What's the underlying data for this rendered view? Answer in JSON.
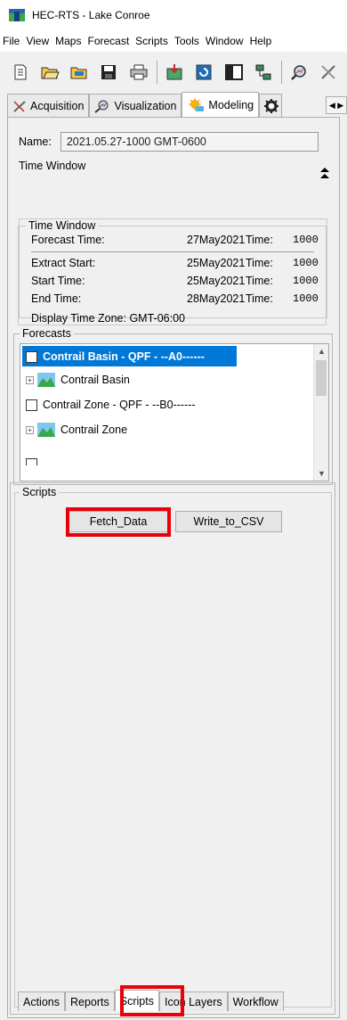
{
  "window": {
    "title": "HEC-RTS - Lake Conroe"
  },
  "menu": [
    "File",
    "View",
    "Maps",
    "Forecast",
    "Scripts",
    "Tools",
    "Window",
    "Help"
  ],
  "toolbar": {
    "buttons": [
      {
        "icon": "new-icon",
        "glyph": "✎"
      },
      {
        "icon": "open-icon",
        "glyph": "📂"
      },
      {
        "icon": "open-folder-icon",
        "glyph": "🗁"
      },
      {
        "icon": "save-icon",
        "glyph": "💾"
      },
      {
        "icon": "print-icon",
        "glyph": "🖶"
      },
      {
        "icon": "import-icon",
        "glyph": "⇲"
      },
      {
        "icon": "refresh-icon",
        "glyph": "⟳"
      },
      {
        "icon": "layout-icon",
        "glyph": "▣"
      },
      {
        "icon": "network-icon",
        "glyph": "⊞"
      },
      {
        "icon": "visualize-icon",
        "glyph": "⌕"
      },
      {
        "icon": "acquisition-icon",
        "glyph": "✗"
      }
    ]
  },
  "tabs": [
    {
      "label": "Acquisition",
      "icon": "acquisition-icon"
    },
    {
      "label": "Visualization",
      "icon": "visualization-icon"
    },
    {
      "label": "Modeling",
      "icon": "modeling-icon",
      "active": true
    }
  ],
  "name": {
    "label": "Name:",
    "value": "2021.05.27-1000 GMT-0600"
  },
  "time_window": {
    "header": "Time Window",
    "box_legend": "Time Window",
    "rows": [
      {
        "label": "Forecast Time:",
        "date": "27May2021",
        "time_label": "Time:",
        "time": "1000"
      },
      {
        "label": "Extract Start:",
        "date": "25May2021",
        "time_label": "Time:",
        "time": "1000"
      },
      {
        "label": "Start Time:",
        "date": "25May2021",
        "time_label": "Time:",
        "time": "1000"
      },
      {
        "label": "End Time:",
        "date": "28May2021",
        "time_label": "Time:",
        "time": "1000"
      }
    ],
    "display_tz": "Display Time Zone: GMT-06:00"
  },
  "forecasts": {
    "legend": "Forecasts",
    "items": [
      {
        "label": "Contrail Basin - QPF - --A0------",
        "type": "checkbox",
        "selected": true
      },
      {
        "label": "Contrail Basin",
        "type": "tree"
      },
      {
        "label": "Contrail Zone - QPF - --B0------",
        "type": "checkbox"
      },
      {
        "label": "Contrail Zone",
        "type": "tree"
      }
    ]
  },
  "scripts": {
    "outer_legend": "",
    "legend": "Scripts",
    "buttons": [
      "Fetch_Data",
      "Write_to_CSV"
    ]
  },
  "bottom_tabs": [
    {
      "label": "Actions"
    },
    {
      "label": "Reports"
    },
    {
      "label": "Scripts",
      "active": true
    },
    {
      "label": "Icon Layers"
    },
    {
      "label": "Workflow"
    }
  ],
  "highlight_color": "#e8000b",
  "selection_color": "#0078d7"
}
